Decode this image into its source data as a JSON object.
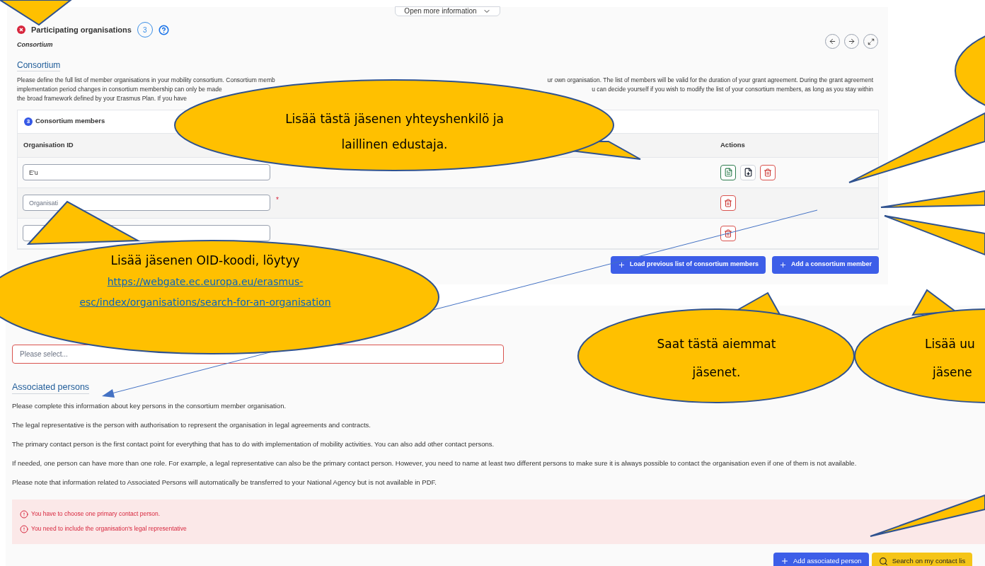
{
  "top_panel": {
    "info_toggle": "Open more information",
    "section": {
      "title": "Participating organisations",
      "count": "3",
      "subtitle": "Consortium"
    },
    "consortium": {
      "heading": "Consortium",
      "lines": [
        {
          "left": "Please define the full list of member organisations in your mobility consortium. Consortium memb",
          "right": "ur own organisation. The list of members will be valid for the duration of your grant agreement. During the grant agreement"
        },
        {
          "left": "implementation period changes in consortium membership can only be made",
          "right": "u can decide yourself if you wish to modify the list of your consortium members, as long as you stay within"
        },
        {
          "left": "the broad framework defined by your Erasmus Plan. If you have"
        }
      ]
    },
    "members": {
      "count": "3",
      "title": "Consortium members",
      "columns": [
        "Organisation ID",
        "Actions"
      ],
      "rows": [
        {
          "value": "E'u",
          "actions": [
            {
              "kind": "edit"
            },
            {
              "kind": "download"
            },
            {
              "kind": "delete"
            }
          ]
        },
        {
          "placeholder": "Organisati",
          "required_mark": "*",
          "actions": [
            {
              "kind": "delete"
            }
          ]
        },
        {
          "actions": [
            {
              "kind": "delete"
            }
          ]
        }
      ]
    },
    "buttons": [
      "Load previous list of consortium members",
      "Add a consortium member"
    ]
  },
  "bottom_panel": {
    "select_placeholder": "Please select...",
    "heading": "Associated persons",
    "paragraphs": [
      "Please complete this information about key persons in the consortium member organisation.",
      "The legal representative is the person with authorisation to represent the organisation in legal agreements and contracts.",
      "The primary contact person is the first contact point for everything that has to do with implementation of mobility activities. You can also add other contact persons.",
      "If needed, one person can have more than one role. For example, a legal representative can also be the primary contact person. However, you need to name at least two different persons to make sure it is always possible to contact the organisation even if one of them is not available.",
      "Please note that information related to Associated Persons will automatically be transferred to your National Agency but is not available in PDF."
    ],
    "errors": [
      "You have to choose one primary contact person.",
      "You need to include the organisation's legal representative"
    ],
    "buttons": [
      {
        "kind": "add",
        "label": "Add associated person"
      },
      {
        "kind": "search",
        "label": "Search on my contact lis"
      }
    ]
  },
  "callouts": [
    {
      "lines": [
        "Lisää tästä jäsenen yhteyshenkilö ja",
        "laillinen edustaja."
      ]
    },
    {
      "lines": [
        "Lisää jäsenen OID-koodi, löytyy"
      ],
      "link_lines": [
        "https://webgate.ec.europa.eu/erasmus-",
        "esc/index/organisations/search-for-an-organisation"
      ]
    },
    {
      "lines": [
        "Saat tästä aiemmat",
        "jäsenet."
      ]
    },
    {
      "lines": [
        "Lisää uu",
        "jäsene"
      ]
    }
  ]
}
